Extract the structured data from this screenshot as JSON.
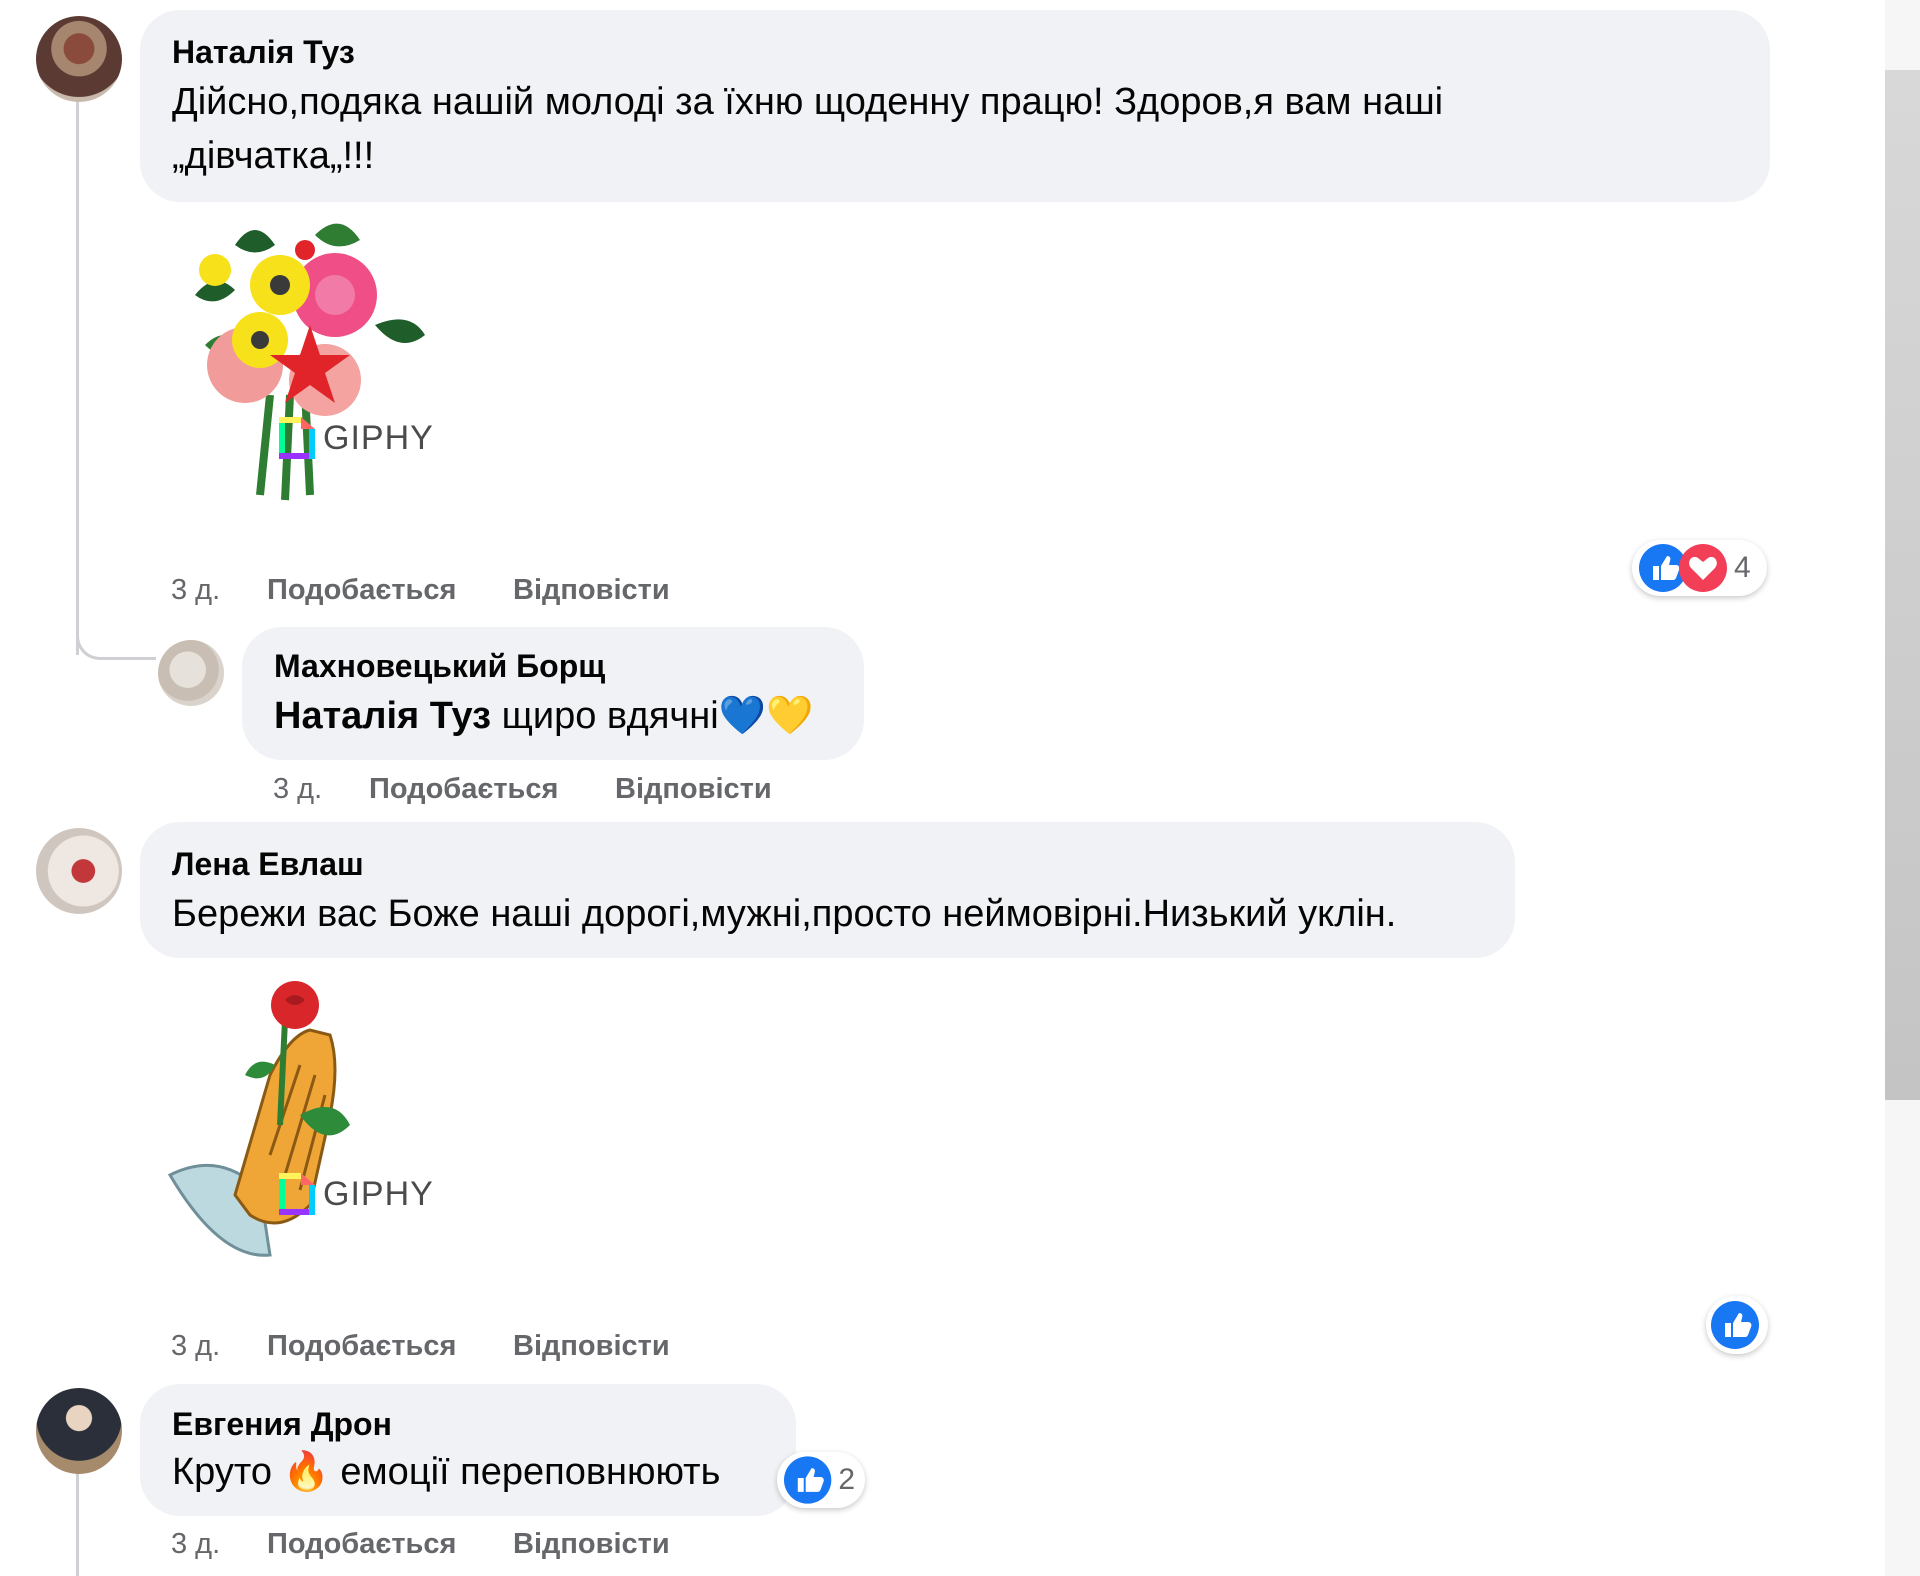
{
  "comments": [
    {
      "author": "Наталія Туз",
      "text_line1": "Дійсно,подяка нашій молоді за їхню щоденну працю! Здоров,я вам наші",
      "text_line2": "„дівчатка„!!!",
      "gif_label": "GIPHY",
      "time": "3 д.",
      "like_label": "Подобається",
      "reply_label": "Відповісти",
      "reactions": {
        "icons": [
          "like-icon",
          "love-icon"
        ],
        "count": "4"
      }
    },
    {
      "author": "Махновецький Борщ",
      "mention": "Наталія Туз",
      "text": "щиро вдячні💙💛",
      "time": "3 д.",
      "like_label": "Подобається",
      "reply_label": "Відповісти"
    },
    {
      "author": "Лена Евлаш",
      "text": "Бережи вас Боже наші дорогі,мужні,просто неймовірні.Низький уклін.",
      "gif_label": "GIPHY",
      "time": "3 д.",
      "like_label": "Подобається",
      "reply_label": "Відповісти",
      "reactions": {
        "icons": [
          "like-icon"
        ]
      }
    },
    {
      "author": "Евгения Дрон",
      "text_a": "Круто",
      "emoji": "🔥",
      "text_b": "емоції переповнюють",
      "time": "3 д.",
      "like_label": "Подобається",
      "reply_label": "Відповісти",
      "reactions": {
        "icons": [
          "like-icon"
        ],
        "count": "2"
      }
    }
  ],
  "colors": {
    "bubble": "#f0f2f5",
    "meta_text": "#65676b",
    "like_blue": "#1877f2",
    "love_red": "#f33e58"
  }
}
